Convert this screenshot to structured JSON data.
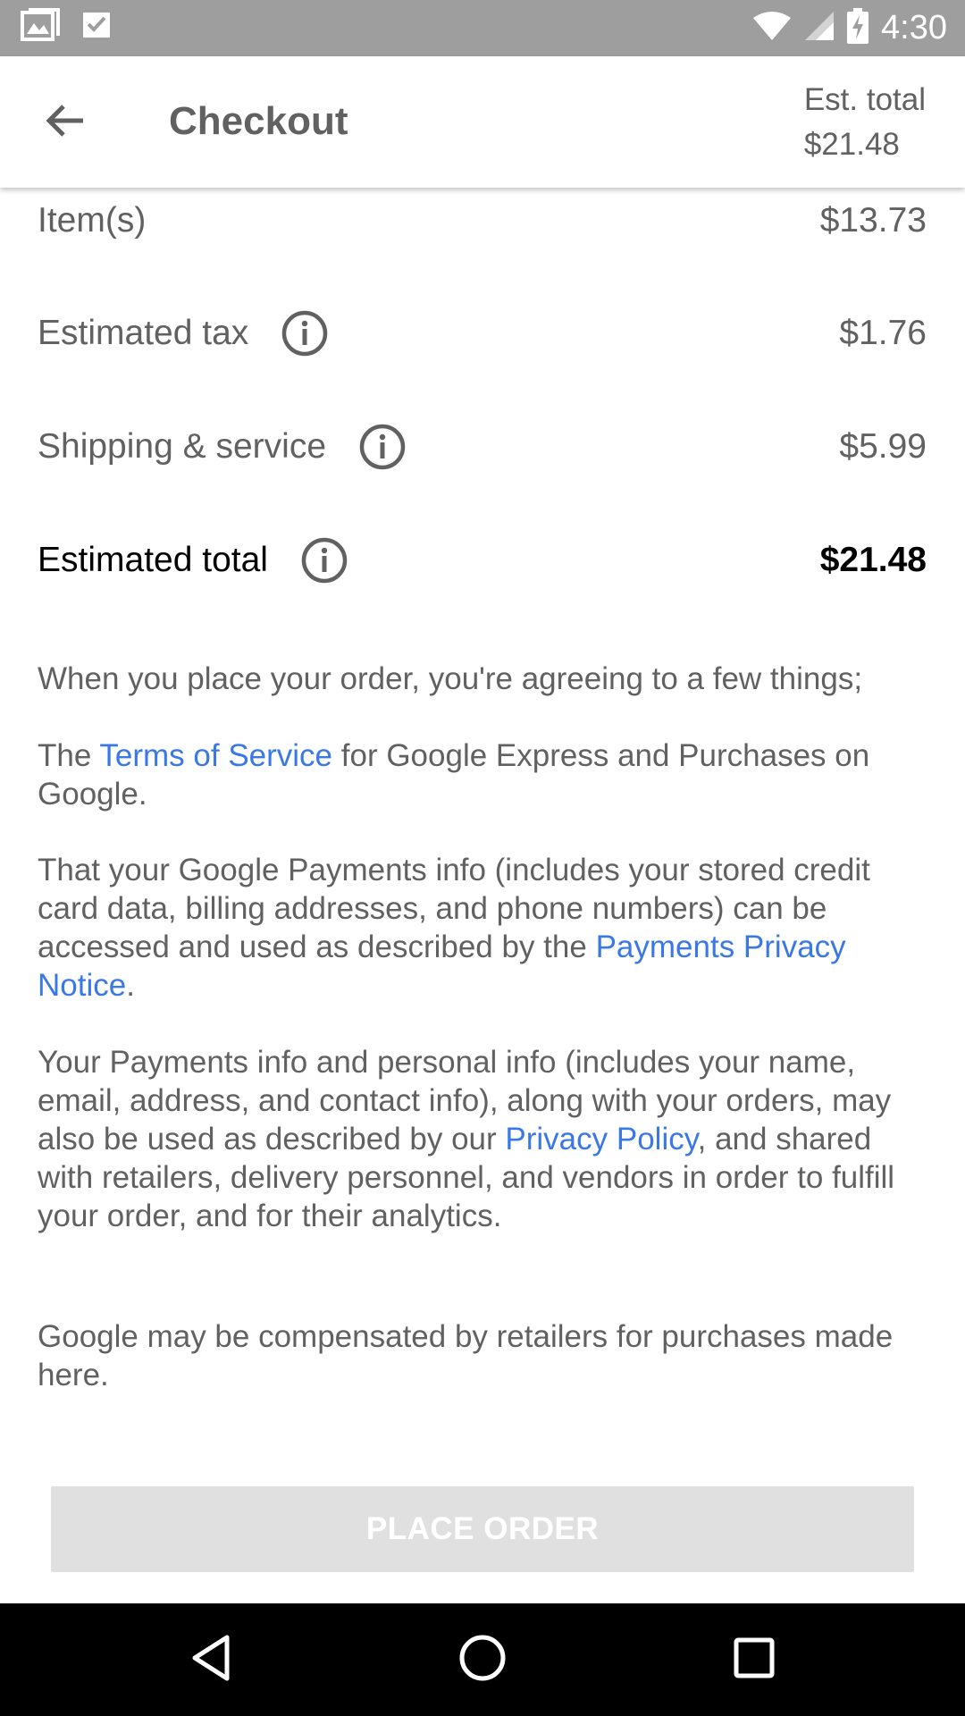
{
  "status_bar": {
    "time": "4:30",
    "left_icons": [
      "gallery-icon",
      "inbox-check-icon"
    ],
    "right_icons": [
      "wifi-icon",
      "signal-icon",
      "battery-charging-icon"
    ]
  },
  "header": {
    "title": "Checkout",
    "est_total_label": "Est. total",
    "est_total_value": "$21.48"
  },
  "summary": {
    "items": {
      "label": "Item(s)",
      "value": "$13.73"
    },
    "tax": {
      "label": "Estimated tax",
      "value": "$1.76"
    },
    "shipping": {
      "label": "Shipping & service",
      "value": "$5.99"
    },
    "total": {
      "label": "Estimated total",
      "value": "$21.48"
    }
  },
  "legal": {
    "intro": "When you place your order, you're agreeing to a few things;",
    "p1_before": "The ",
    "p1_link": "Terms of Service",
    "p1_after": " for Google Express and Purchases on Google.",
    "p2_before": "That your Google Payments info (includes your stored credit card data, billing addresses, and phone numbers) can be accessed and used as described by the ",
    "p2_link": "Payments Privacy Notice",
    "p2_after": ".",
    "p3_before": "Your Payments info and personal info (includes your name, email, address, and contact info), along with your orders, may also be used as described by our ",
    "p3_link": "Privacy Policy",
    "p3_after": ", and shared with retailers, delivery personnel, and vendors in order to fulfill your order, and for their analytics.",
    "compensation": "Google may be compensated by retailers for purchases made here."
  },
  "actions": {
    "place_order": "PLACE ORDER"
  },
  "colors": {
    "link": "#3b78e7",
    "status_bar": "#9e9e9e",
    "button_disabled": "#e0e0e0"
  }
}
